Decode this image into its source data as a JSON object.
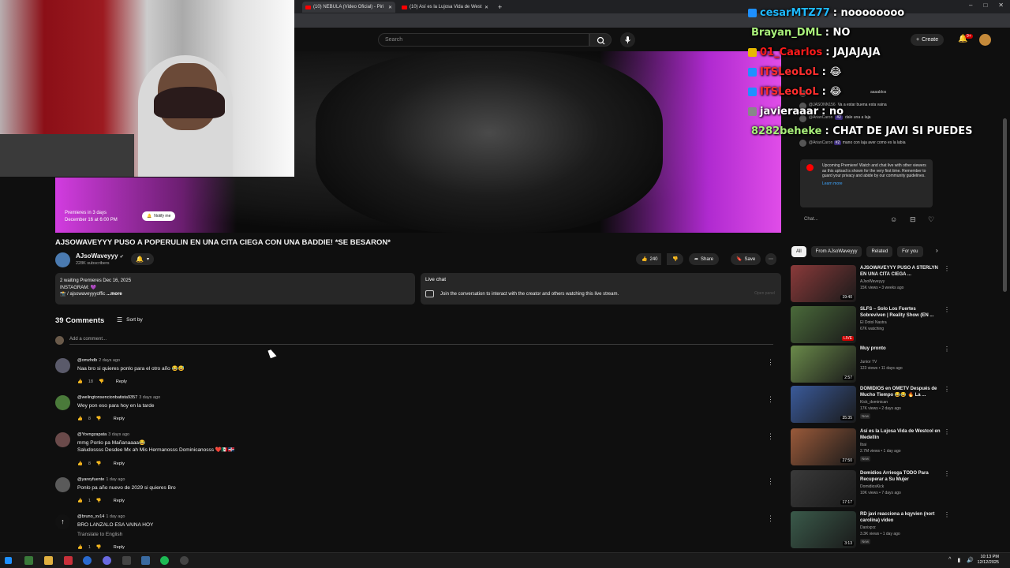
{
  "browser": {
    "tabs": [
      {
        "label": "(10) NEBULA (Video Oficial) - Piri"
      },
      {
        "label": "(10) Así es la Lujosa Vida de West"
      }
    ],
    "window_controls": [
      "–",
      "□",
      "✕"
    ],
    "new_tab": "+"
  },
  "masthead": {
    "search_placeholder": "Search",
    "create_label": "Create",
    "notifications": "9+"
  },
  "twitch_chat": [
    {
      "user": "cesarMTZ77",
      "msg": ": noooooooo",
      "color": "#1eb9ff",
      "badge": "#1e90ff"
    },
    {
      "user": "Brayan_DML",
      "msg": ": NO",
      "color": "#a9f07a",
      "badge": ""
    },
    {
      "user": "01_Caarlos",
      "msg": ": JAJAJAJA",
      "color": "#ff1a1a",
      "badge": "#e6b800"
    },
    {
      "user": "ITSLeoLoL",
      "msg": ": 😂",
      "color": "#ff2d2d",
      "badge": "#1e90ff"
    },
    {
      "user": "ITSLeoLoL",
      "msg": ": 😂",
      "color": "#ff2d2d",
      "badge": "#1e90ff"
    },
    {
      "user": "javieraaar",
      "msg": ": no",
      "color": "#ffffff",
      "badge": "#888888"
    },
    {
      "user": "8282beheke",
      "msg": ": CHAT DE JAVI SI PUEDES",
      "color": "#a9f07a",
      "badge": ""
    }
  ],
  "yt_chat": {
    "messages": [
      {
        "name": "",
        "text": "aaaablos"
      },
      {
        "name": "@JASONN156",
        "text": "Va a estar buena esta vaina"
      },
      {
        "name": "@ArianCaron",
        "badge": "#2",
        "text": "dale una a laja"
      },
      {
        "name": "@ArianCaron",
        "badge": "#2",
        "text": "mano con laja aver como es la labia"
      }
    ],
    "notice": "Upcoming Premiere! Watch and chat live with other viewers as this upload is shown for the very first time. Remember to guard your privacy and abide by our community guidelines.",
    "learn_more": "Learn more",
    "input_placeholder": "Chat..."
  },
  "player": {
    "premiere_line1": "Premieres in 3 days",
    "premiere_line2": "December 16 at 6:00 PM",
    "notify_label": "Notify me"
  },
  "video": {
    "title": "AJSOWAVEYYY PUSO A POPERULIN EN UNA CITA CIEGA CON UNA BADDIE! *SE BESARON*",
    "channel": "AJsoWaveyyy",
    "subscribers": "228K subscribers",
    "likes": "240",
    "share": "Share",
    "save": "Save"
  },
  "description": {
    "line1": "2 waiting  Premieres Dec 16, 2025",
    "line2": "INSTAGRAM: 💜",
    "line3": "📸 / ajsowaveyyyoffic",
    "more": "...more"
  },
  "live_chat_card": {
    "title": "Live chat",
    "text": "Join the conversation to interact with the creator and others watching this live stream.",
    "button": "Open panel"
  },
  "comments": {
    "count_label": "39 Comments",
    "sort_label": "Sort by",
    "add_placeholder": "Add a comment...",
    "items": [
      {
        "author": "@omzhdb",
        "ago": "2 days ago",
        "text": "Naa bro si quieres ponlo para el otro año 😂😅",
        "likes": "18"
      },
      {
        "author": "@welingtonsencionbatista9357",
        "ago": "3 days ago",
        "text": "Wey pon eso para hoy en la tarde",
        "likes": "8"
      },
      {
        "author": "@Yovngzapata",
        "ago": "3 days ago",
        "text": "mmg Ponlo pa Mañanaaaa😂",
        "text2": "Saludossss Desdee Mx ah Mis Hermanosss Dominicanosss ❤️🇲🇽🇩🇴",
        "likes": "8"
      },
      {
        "author": "@yareyfuente",
        "ago": "1 day ago",
        "text": "Ponlo pa año nuevo de 2029 si quieres Bro",
        "likes": "1"
      },
      {
        "author": "@bruno_xv14",
        "ago": "1 day ago",
        "text": "BRO LANZALO ESA VAINA HOY",
        "text2": "Translate to English",
        "likes": "1"
      }
    ],
    "reply_label": "Reply"
  },
  "chips": [
    "All",
    "From AJsoWaveyyy",
    "Related",
    "For you"
  ],
  "recommendations": [
    {
      "title": "AJSOWAVEYYY PUSO A STERLYN EN UNA CITA CIEGA ...",
      "channel": "AJsoWaveyyy",
      "meta": "15K views • 3 weeks ago",
      "duration": "19:40",
      "thumb": "#8a3a3a"
    },
    {
      "title": "SLFS – Solo Los Fuertes Sobreviven | Reality Show (EN ...",
      "channel": "El Dotol Nastra",
      "meta": "67K watching",
      "duration": "LIVE",
      "thumb": "#4a6a3a"
    },
    {
      "title": "Muy pronto",
      "channel": "Junior TV",
      "meta": "123 views • 11 days ago",
      "duration": "2:57",
      "thumb": "#6a8a4a"
    },
    {
      "title": "DOMIDIOS en OMETV Después de Mucho Tiempo 😂😂 🔥 La ...",
      "channel": "Kick_dominican",
      "meta": "17K views • 2 days ago",
      "duration": "35:35",
      "thumb": "#3a5a9a",
      "new": "New"
    },
    {
      "title": "Así es la Lujosa Vida de Westcol en Medellín",
      "channel": "Ibai",
      "meta": "2.7M views • 1 day ago",
      "duration": "27:50",
      "thumb": "#9a5a3a",
      "new": "New"
    },
    {
      "title": "Domidios Arriesga TODO Para Recuperar a Su Mujer",
      "channel": "DomidiosKick",
      "meta": "10K views • 7 days ago",
      "duration": "17:17",
      "thumb": "#3a3a3a"
    },
    {
      "title": "RD javi reacciona a kqyvien (nort carolina) video",
      "channel": "Danixprz",
      "meta": "3.3K views • 1 day ago",
      "duration": "3:13",
      "thumb": "#3a5a4a",
      "new": "New"
    }
  ],
  "taskbar": {
    "time": "10:13 PM",
    "date": "12/12/2025"
  }
}
